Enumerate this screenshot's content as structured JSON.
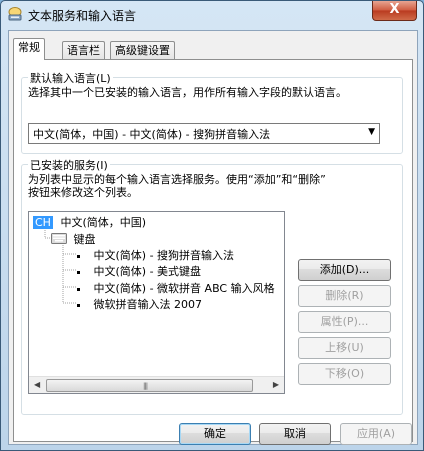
{
  "window": {
    "title": "文本服务和输入语言",
    "close_label": "X"
  },
  "tabs": [
    {
      "label": "常规"
    },
    {
      "label": "语言栏"
    },
    {
      "label": "高级键设置"
    }
  ],
  "default_language": {
    "group_title": "默认输入语言(L)",
    "description": "选择其中一个已安装的输入语言，用作所有输入字段的默认语言。",
    "selected_value": "中文(简体，中国) - 中文(简体) - 搜狗拼音输入法"
  },
  "installed_services": {
    "group_title": "已安装的服务(I)",
    "description_line1": "为列表中显示的每个输入语言选择服务。使用“添加”和“删除”",
    "description_line2": "按钮来修改这个列表。",
    "tree": {
      "language_badge": "CH",
      "language_label": "中文(简体，中国)",
      "category_label": "键盘",
      "items": [
        "中文(简体) - 搜狗拼音输入法",
        "中文(简体) - 美式键盘",
        "中文(简体) - 微软拼音 ABC 输入风格",
        "微软拼音输入法 2007"
      ]
    },
    "buttons": {
      "add": "添加(D)...",
      "remove": "删除(R)",
      "properties": "属性(P)...",
      "move_up": "上移(U)",
      "move_down": "下移(O)"
    }
  },
  "footer": {
    "ok": "确定",
    "cancel": "取消",
    "apply": "应用(A)"
  },
  "icons": {
    "app": "keyboard-app-icon",
    "keyboard": "keyboard-icon",
    "close": "close-icon"
  },
  "colors": {
    "language_badge_bg": "#3399ff",
    "title_bar": "#bcd4ea",
    "close_button": "#cf5a3f"
  }
}
